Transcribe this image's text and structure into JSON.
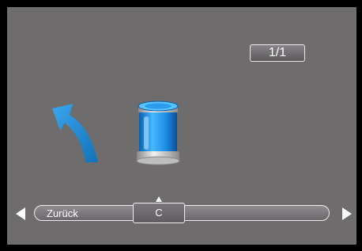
{
  "page_counter": "1/1",
  "icons": {
    "undo": "curved-back-arrow-icon",
    "item": "blue-canister-icon",
    "nav_left": "left-triangle-icon",
    "nav_right": "right-triangle-icon"
  },
  "scrollbar": {
    "back_label": "Zurück",
    "thumb_label": "C"
  },
  "colors": {
    "background": "#6e6c6d",
    "arrow_blue": "#1a86d4",
    "canister_blue": "#1e8ee6"
  }
}
